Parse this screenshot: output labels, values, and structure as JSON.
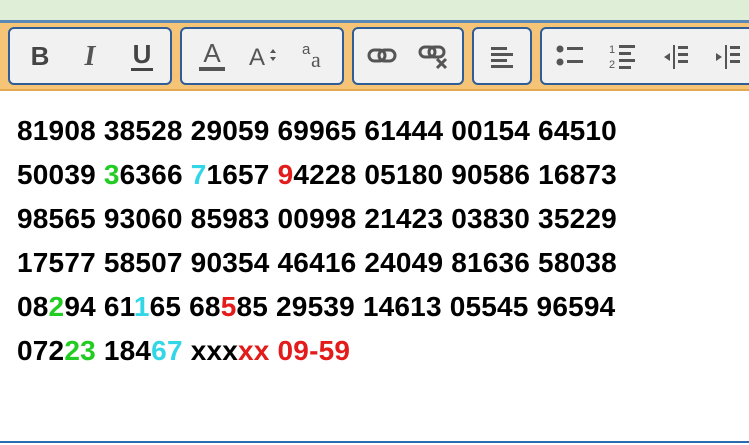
{
  "toolbar": {
    "colors": {
      "band": "#f6c476",
      "group_border": "#2f5d96",
      "group_bg": "#f1f1f1",
      "icon": "#444444"
    },
    "groups": [
      {
        "name": "text-style",
        "buttons": [
          {
            "icon": "bold-icon",
            "label": "B"
          },
          {
            "icon": "italic-icon",
            "label": "I"
          },
          {
            "icon": "underline-icon",
            "label": "U"
          }
        ]
      },
      {
        "name": "font",
        "buttons": [
          {
            "icon": "font-color-icon",
            "label": "A"
          },
          {
            "icon": "font-size-icon",
            "label": "A"
          },
          {
            "icon": "font-family-icon",
            "label": "aa"
          }
        ]
      },
      {
        "name": "link",
        "buttons": [
          {
            "icon": "link-icon"
          },
          {
            "icon": "unlink-icon"
          }
        ]
      },
      {
        "name": "align",
        "buttons": [
          {
            "icon": "align-left-icon"
          }
        ]
      },
      {
        "name": "lists",
        "buttons": [
          {
            "icon": "bulleted-list-icon"
          },
          {
            "icon": "numbered-list-icon"
          },
          {
            "icon": "outdent-icon"
          },
          {
            "icon": "indent-icon"
          }
        ]
      }
    ]
  },
  "editor": {
    "colors": {
      "green": "#22cc22",
      "cyan": "#33d6e6",
      "red": "#e31b1b",
      "black": "#000000"
    },
    "lines": [
      [
        {
          "t": "81908 38528 29059 69965 61444 00154 64510",
          "c": "black"
        }
      ],
      [
        {
          "t": "50039 ",
          "c": "black"
        },
        {
          "t": "3",
          "c": "green"
        },
        {
          "t": "6366 ",
          "c": "black"
        },
        {
          "t": "7",
          "c": "cyan"
        },
        {
          "t": "1657 ",
          "c": "black"
        },
        {
          "t": "9",
          "c": "red"
        },
        {
          "t": "4228 05180 90586 16873",
          "c": "black"
        }
      ],
      [
        {
          "t": "98565 93060 85983 00998 21423 03830 35229",
          "c": "black"
        }
      ],
      [
        {
          "t": "17577 58507 90354 46416 24049 81636 58038",
          "c": "black"
        }
      ],
      [
        {
          "t": "08",
          "c": "black"
        },
        {
          "t": "2",
          "c": "green"
        },
        {
          "t": "94 61",
          "c": "black"
        },
        {
          "t": "1",
          "c": "cyan"
        },
        {
          "t": "65 68",
          "c": "black"
        },
        {
          "t": "5",
          "c": "red"
        },
        {
          "t": "85 29539 14613 05545 96594",
          "c": "black"
        }
      ],
      [
        {
          "t": "072",
          "c": "black"
        },
        {
          "t": "23",
          "c": "green"
        },
        {
          "t": " 184",
          "c": "black"
        },
        {
          "t": "67",
          "c": "cyan"
        },
        {
          "t": " xxx",
          "c": "black"
        },
        {
          "t": "xx 09-59",
          "c": "red"
        }
      ]
    ]
  }
}
